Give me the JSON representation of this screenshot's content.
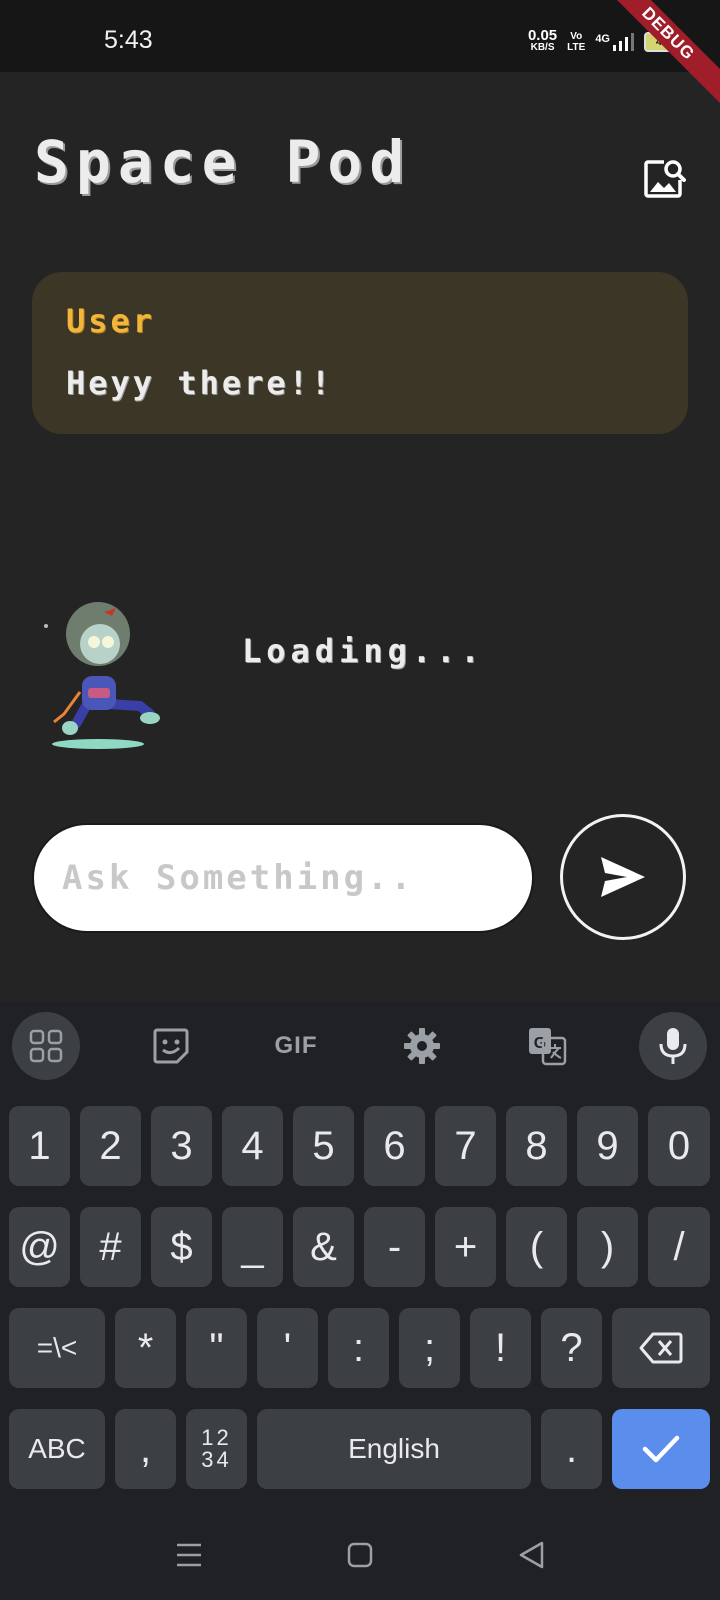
{
  "status_bar": {
    "time": "5:43",
    "net_speed_value": "0.05",
    "net_speed_unit": "KB/S",
    "volte_top": "Vo",
    "volte_bottom": "LTE",
    "network": "4G",
    "battery": "43",
    "debug_banner": "DEBUG"
  },
  "header": {
    "title": "Space Pod",
    "image_search_icon": "image-search-icon"
  },
  "chat": {
    "messages": [
      {
        "role": "User",
        "text": "Heyy there!!"
      }
    ],
    "loading_text": "Loading..."
  },
  "input": {
    "placeholder": "Ask Something..",
    "value": "",
    "send_icon": "send-icon"
  },
  "keyboard": {
    "toolbar": {
      "apps_icon": "apps-grid-icon",
      "sticker_icon": "sticker-icon",
      "gif_label": "GIF",
      "settings_icon": "gear-icon",
      "translate_icon": "translate-icon",
      "mic_icon": "mic-icon"
    },
    "row1": [
      "1",
      "2",
      "3",
      "4",
      "5",
      "6",
      "7",
      "8",
      "9",
      "0"
    ],
    "row2": [
      "@",
      "#",
      "$",
      "_",
      "&",
      "-",
      "+",
      "(",
      ")",
      "/"
    ],
    "row3": [
      "=\\<",
      "*",
      "\"",
      "'",
      ":",
      ";",
      "!",
      "?"
    ],
    "row4": {
      "abc": "ABC",
      "comma": ",",
      "num_top": "12",
      "num_bottom": "34",
      "space": "English",
      "period": "."
    }
  },
  "colors": {
    "background": "#242424",
    "user_bubble": "#3c3627",
    "user_role": "#f2b63a",
    "enter_key": "#5b8ded"
  }
}
